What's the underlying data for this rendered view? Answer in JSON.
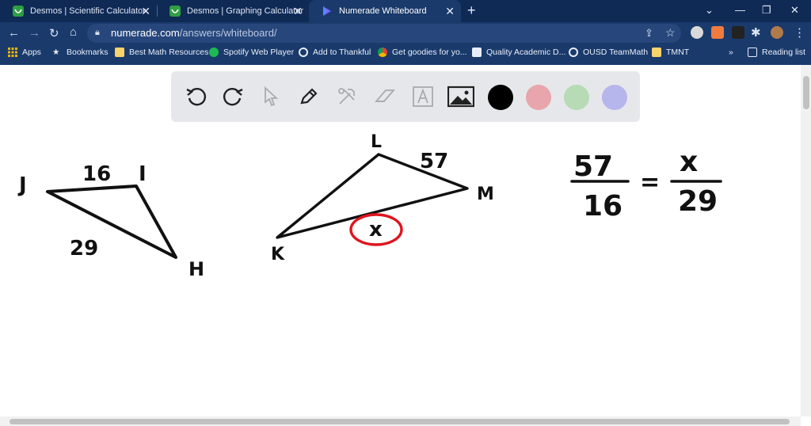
{
  "tabs": [
    {
      "title": "Desmos | Scientific Calculator",
      "active": false,
      "favicon": "desmos-icon"
    },
    {
      "title": "Desmos | Graphing Calculator",
      "active": false,
      "favicon": "desmos-icon"
    },
    {
      "title": "Numerade Whiteboard",
      "active": true,
      "favicon": "numerade-icon"
    }
  ],
  "address": {
    "domain": "numerade.com",
    "path": "/answers/whiteboard/"
  },
  "bookmarks": {
    "apps": "Apps",
    "items": [
      {
        "label": "Bookmarks",
        "icon": "star-icon"
      },
      {
        "label": "Best Math Resources",
        "icon": "folder-icon"
      },
      {
        "label": "Spotify Web Player",
        "icon": "spotify-icon"
      },
      {
        "label": "Add to Thankful",
        "icon": "globe-icon"
      },
      {
        "label": "Get goodies for yo...",
        "icon": "chrome-icon"
      },
      {
        "label": "Quality Academic D...",
        "icon": "doc-icon"
      },
      {
        "label": "OUSD TeamMath",
        "icon": "globe-icon"
      },
      {
        "label": "TMNT",
        "icon": "folder-icon"
      }
    ],
    "overflow": "»",
    "reading_list": "Reading list"
  },
  "toolbar": {
    "tools": [
      "undo-icon",
      "redo-icon",
      "pointer-icon",
      "pen-icon",
      "tools-icon",
      "eraser-icon",
      "text-icon",
      "image-icon"
    ],
    "colors": [
      "#000000",
      "#e8a5ab",
      "#b6dbb5",
      "#b6b5ec"
    ]
  },
  "whiteboard": {
    "triangle1": {
      "J": "J",
      "I": "I",
      "H": "H",
      "side_ji": "16",
      "side_jh": "29"
    },
    "triangle2": {
      "L": "L",
      "M": "M",
      "K": "K",
      "side_lm": "57",
      "side_km": "x"
    },
    "proportion": {
      "num_left": "57",
      "den_left": "16",
      "equals": "=",
      "num_right": "x",
      "den_right": "29"
    },
    "ink_color": "#111111",
    "highlight_color": "#e0141e"
  }
}
